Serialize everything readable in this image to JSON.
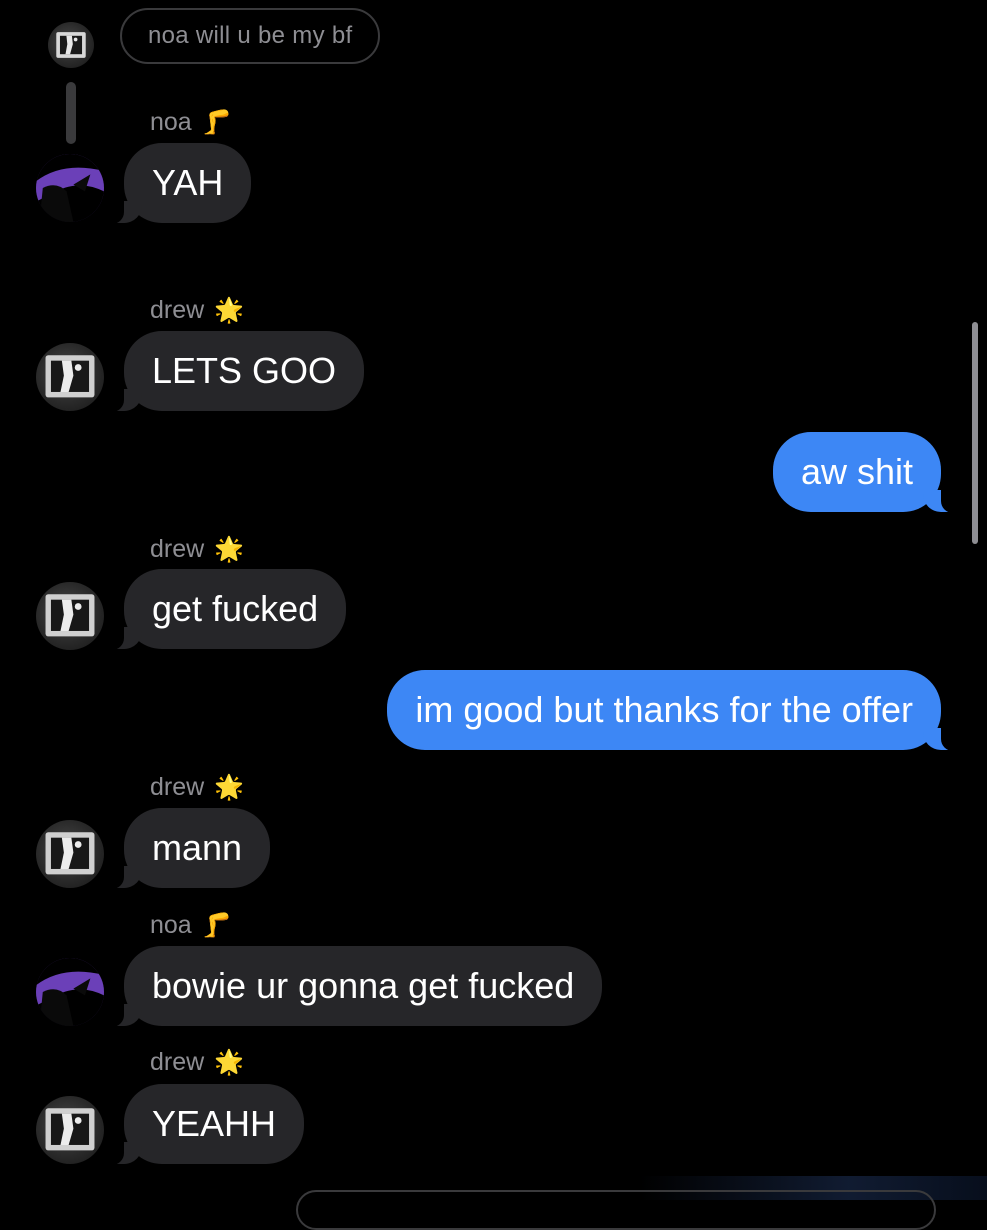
{
  "reply": {
    "quoted_text": "noa will u be my bf"
  },
  "participants": {
    "noa": {
      "name": "noa",
      "emoji": "🦵",
      "avatar_color": "#5a34a0"
    },
    "drew": {
      "name": "drew",
      "emoji": "🌟",
      "avatar_color": "#3a3a3a"
    }
  },
  "messages": [
    {
      "sender": "noa",
      "emoji": "🦵",
      "text": "YAH",
      "direction": "incoming"
    },
    {
      "sender": "drew",
      "emoji": "🌟",
      "text": "LETS GOO",
      "direction": "incoming"
    },
    {
      "sender": "me",
      "text": "aw shit",
      "direction": "outgoing"
    },
    {
      "sender": "drew",
      "emoji": "🌟",
      "text": "get fucked",
      "direction": "incoming"
    },
    {
      "sender": "me",
      "text": "im good but thanks for the offer",
      "direction": "outgoing"
    },
    {
      "sender": "drew",
      "emoji": "🌟",
      "text": "mann",
      "direction": "incoming"
    },
    {
      "sender": "noa",
      "emoji": "🦵",
      "text": "bowie ur gonna get fucked",
      "direction": "incoming"
    },
    {
      "sender": "drew",
      "emoji": "🌟",
      "text": "YEAHH",
      "direction": "incoming"
    }
  ],
  "colors": {
    "background": "#000000",
    "incoming_bubble": "#262629",
    "outgoing_bubble": "#3d87f5",
    "secondary_text": "#8e8e93"
  },
  "icons": {
    "drew_avatar": "person-silhouette-avatar-icon",
    "noa_avatar": "purple-silhouette-avatar-icon"
  }
}
